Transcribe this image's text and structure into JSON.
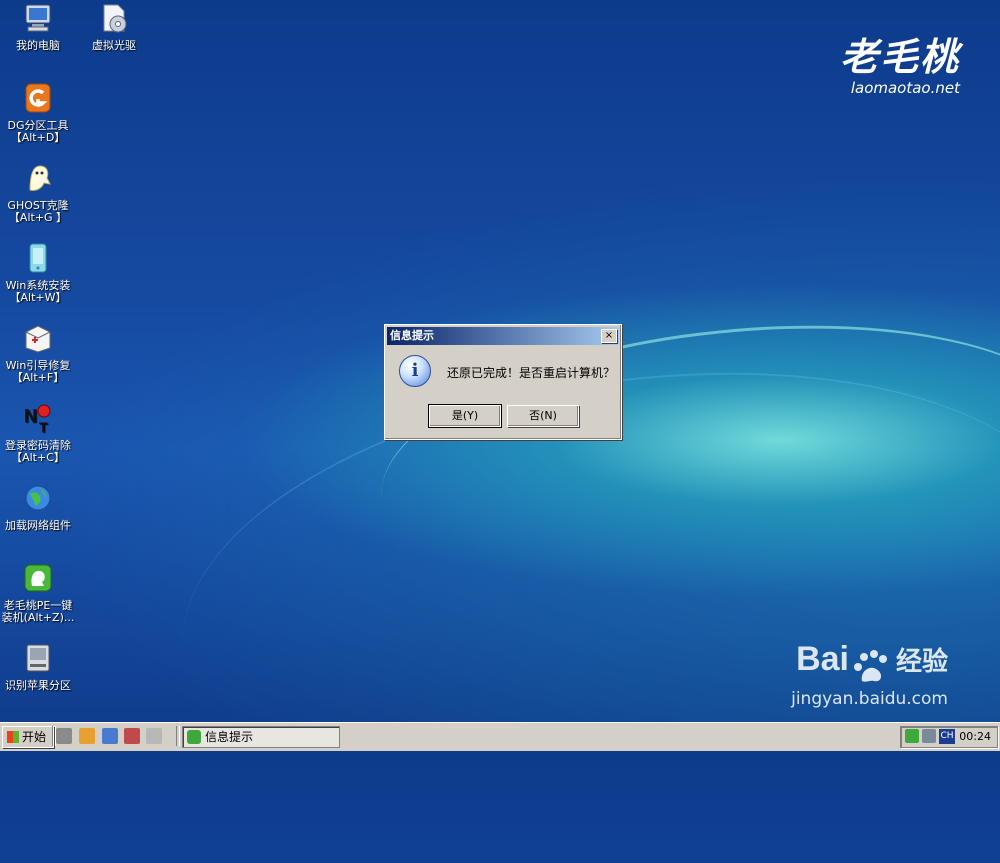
{
  "desktop": {
    "icons": [
      {
        "label": "我的电脑",
        "icon": "computer-icon"
      },
      {
        "label": "虚拟光驱",
        "icon": "virtual-drive-icon"
      },
      {
        "label": "DG分区工具\n【Alt+D】",
        "line1": "DG分区工具",
        "line2": "【Alt+D】",
        "icon": "dg-partition-icon"
      },
      {
        "line1": "GHOST克隆",
        "line2": "【Alt+G 】",
        "icon": "ghost-icon"
      },
      {
        "line1": "Win系统安装",
        "line2": "【Alt+W】",
        "icon": "win-install-icon"
      },
      {
        "line1": "Win引导修复",
        "line2": "【Alt+F】",
        "icon": "boot-repair-icon"
      },
      {
        "line1": "登录密码清除",
        "line2": "【Alt+C】",
        "icon": "password-clear-icon"
      },
      {
        "line1": "加载网络组件",
        "line2": "",
        "icon": "network-icon"
      },
      {
        "line1": "老毛桃PE一键",
        "line2": "装机(Alt+Z)...",
        "icon": "laomaotao-install-icon"
      },
      {
        "line1": "识别苹果分区",
        "line2": "",
        "icon": "apple-partition-icon"
      }
    ],
    "brand": {
      "name": "老毛桃",
      "url": "laomaotao.net"
    },
    "watermark": {
      "brand": "Bai",
      "brand2": "经验",
      "url": "jingyan.baidu.com"
    }
  },
  "dialog": {
    "title": "信息提示",
    "message": "还原已完成！是否重启计算机？",
    "yes_label": "是(Y)",
    "no_label": "否(N)",
    "close_glyph": "×",
    "info_glyph": "i"
  },
  "taskbar": {
    "start_label": "开始",
    "task_label": "信息提示",
    "ime_label": "CH",
    "clock": "00:24"
  },
  "colors": {
    "titlebar_start": "#0a246a",
    "titlebar_end": "#a6caf0",
    "taskbar": "#d4d0c8"
  }
}
